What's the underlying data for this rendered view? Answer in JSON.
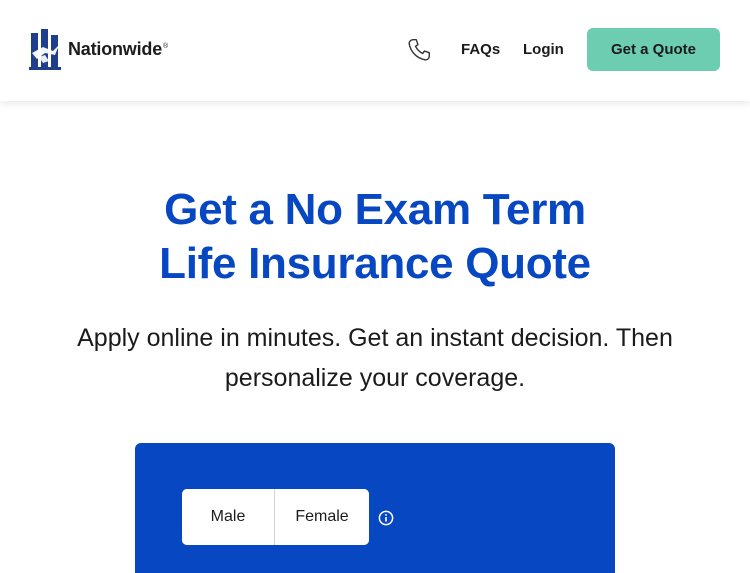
{
  "header": {
    "brand": "Nationwide",
    "brand_reg": "®",
    "phone_icon": "phone-icon",
    "nav": {
      "faqs": "FAQs",
      "login": "Login"
    },
    "cta_label": "Get a Quote"
  },
  "hero": {
    "title_line1": "Get a No Exam Term",
    "title_line2": "Life Insurance Quote",
    "subtitle_line1": "Apply online in minutes. Get an instant decision. Then",
    "subtitle_line2": "personalize your coverage."
  },
  "form": {
    "gender_options": [
      "Male",
      "Female"
    ],
    "info_icon": "info-icon"
  },
  "colors": {
    "brand_blue": "#0747c2",
    "cta_green": "#6ccdb1",
    "logo_navy": "#1f3e8c"
  }
}
